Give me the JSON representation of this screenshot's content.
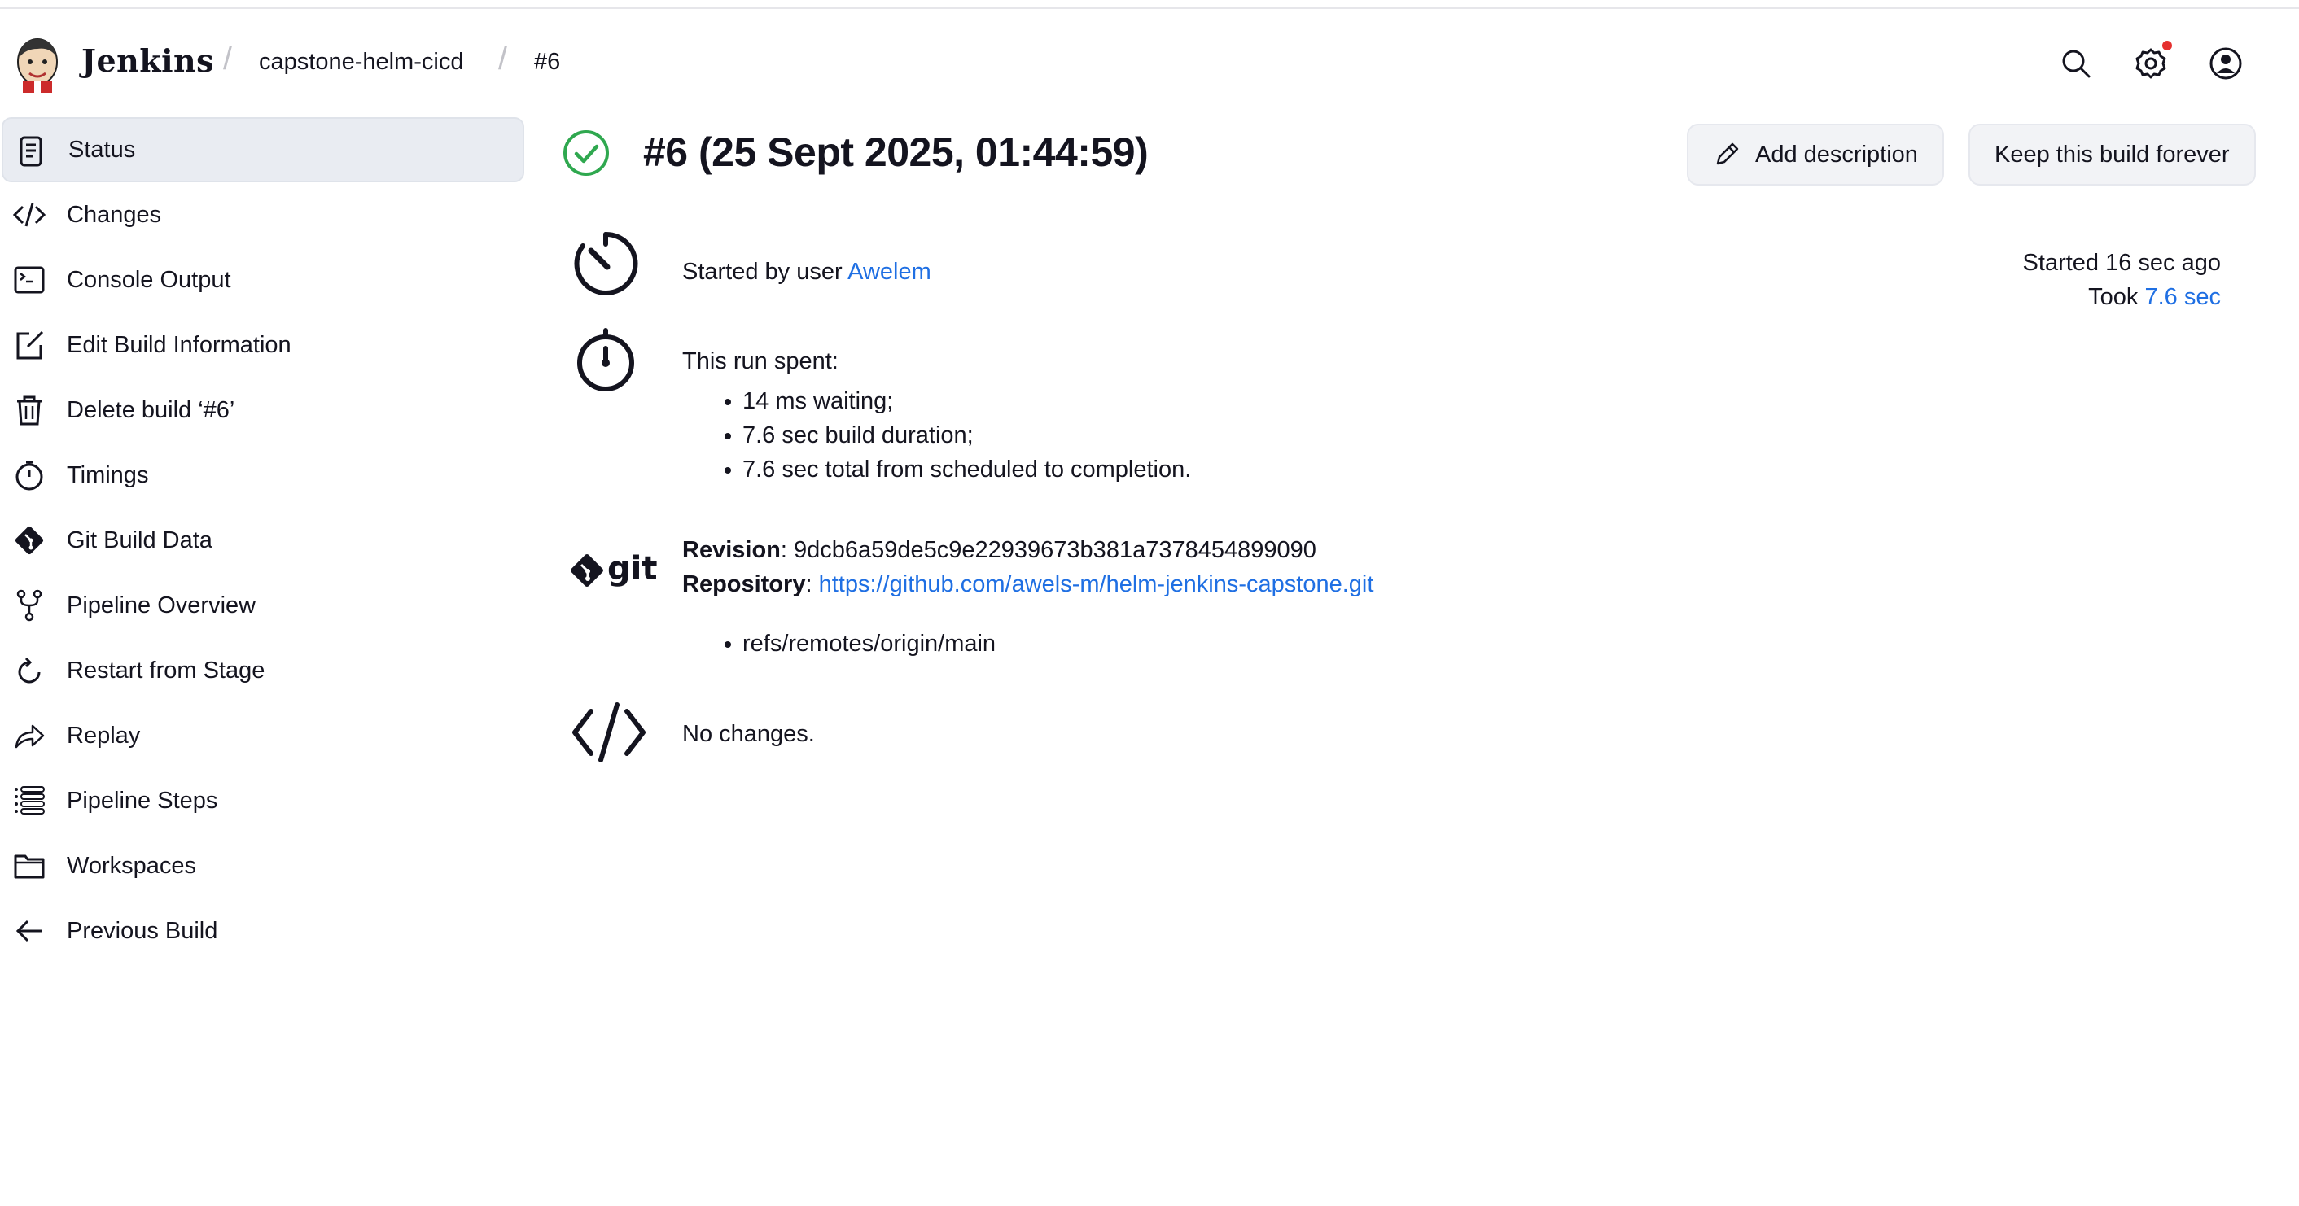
{
  "header": {
    "brand": "Jenkins",
    "breadcrumb": [
      "capstone-helm-cicd",
      "#6"
    ],
    "breadcrumb_sep": "/",
    "icons": [
      "search-icon",
      "settings-icon",
      "user-icon"
    ],
    "notification_color": "#e5302f"
  },
  "sidebar": {
    "items": [
      {
        "label": "Status",
        "icon": "document-icon",
        "active": true
      },
      {
        "label": "Changes",
        "icon": "code-icon"
      },
      {
        "label": "Console Output",
        "icon": "terminal-icon"
      },
      {
        "label": "Edit Build Information",
        "icon": "edit-icon"
      },
      {
        "label": "Delete build ‘#6’",
        "icon": "trash-icon"
      },
      {
        "label": "Timings",
        "icon": "stopwatch-icon"
      },
      {
        "label": "Git Build Data",
        "icon": "git-icon"
      },
      {
        "label": "Pipeline Overview",
        "icon": "fork-icon"
      },
      {
        "label": "Restart from Stage",
        "icon": "restart-icon"
      },
      {
        "label": "Replay",
        "icon": "replay-icon"
      },
      {
        "label": "Pipeline Steps",
        "icon": "list-icon"
      },
      {
        "label": "Workspaces",
        "icon": "folder-icon"
      },
      {
        "label": "Previous Build",
        "icon": "arrow-left-icon"
      }
    ]
  },
  "build": {
    "title": "#6 (25 Sept 2025, 01:44:59)",
    "status_color": "#2fa84f",
    "add_description": "Add description",
    "keep_forever": "Keep this build forever",
    "started_by_prefix": "Started by user ",
    "started_by_user": "Awelem",
    "started_ago": "Started 16 sec ago",
    "took_prefix": "Took ",
    "took_value": "7.6 sec",
    "timing_heading": "This run spent:",
    "timing_items": [
      "14 ms waiting;",
      "7.6 sec build duration;",
      "7.6 sec total from scheduled to completion."
    ],
    "revision_label": "Revision",
    "revision_value": ": 9dcb6a59de5c9e22939673b381a7378454899090",
    "repository_label": "Repository",
    "repository_sep": ": ",
    "repository_url": "https://github.com/awels-m/helm-jenkins-capstone.git",
    "refs": [
      "refs/remotes/origin/main"
    ],
    "git_logo_text": "git",
    "changes_text": "No changes.",
    "link_color": "#1f6fe3"
  }
}
